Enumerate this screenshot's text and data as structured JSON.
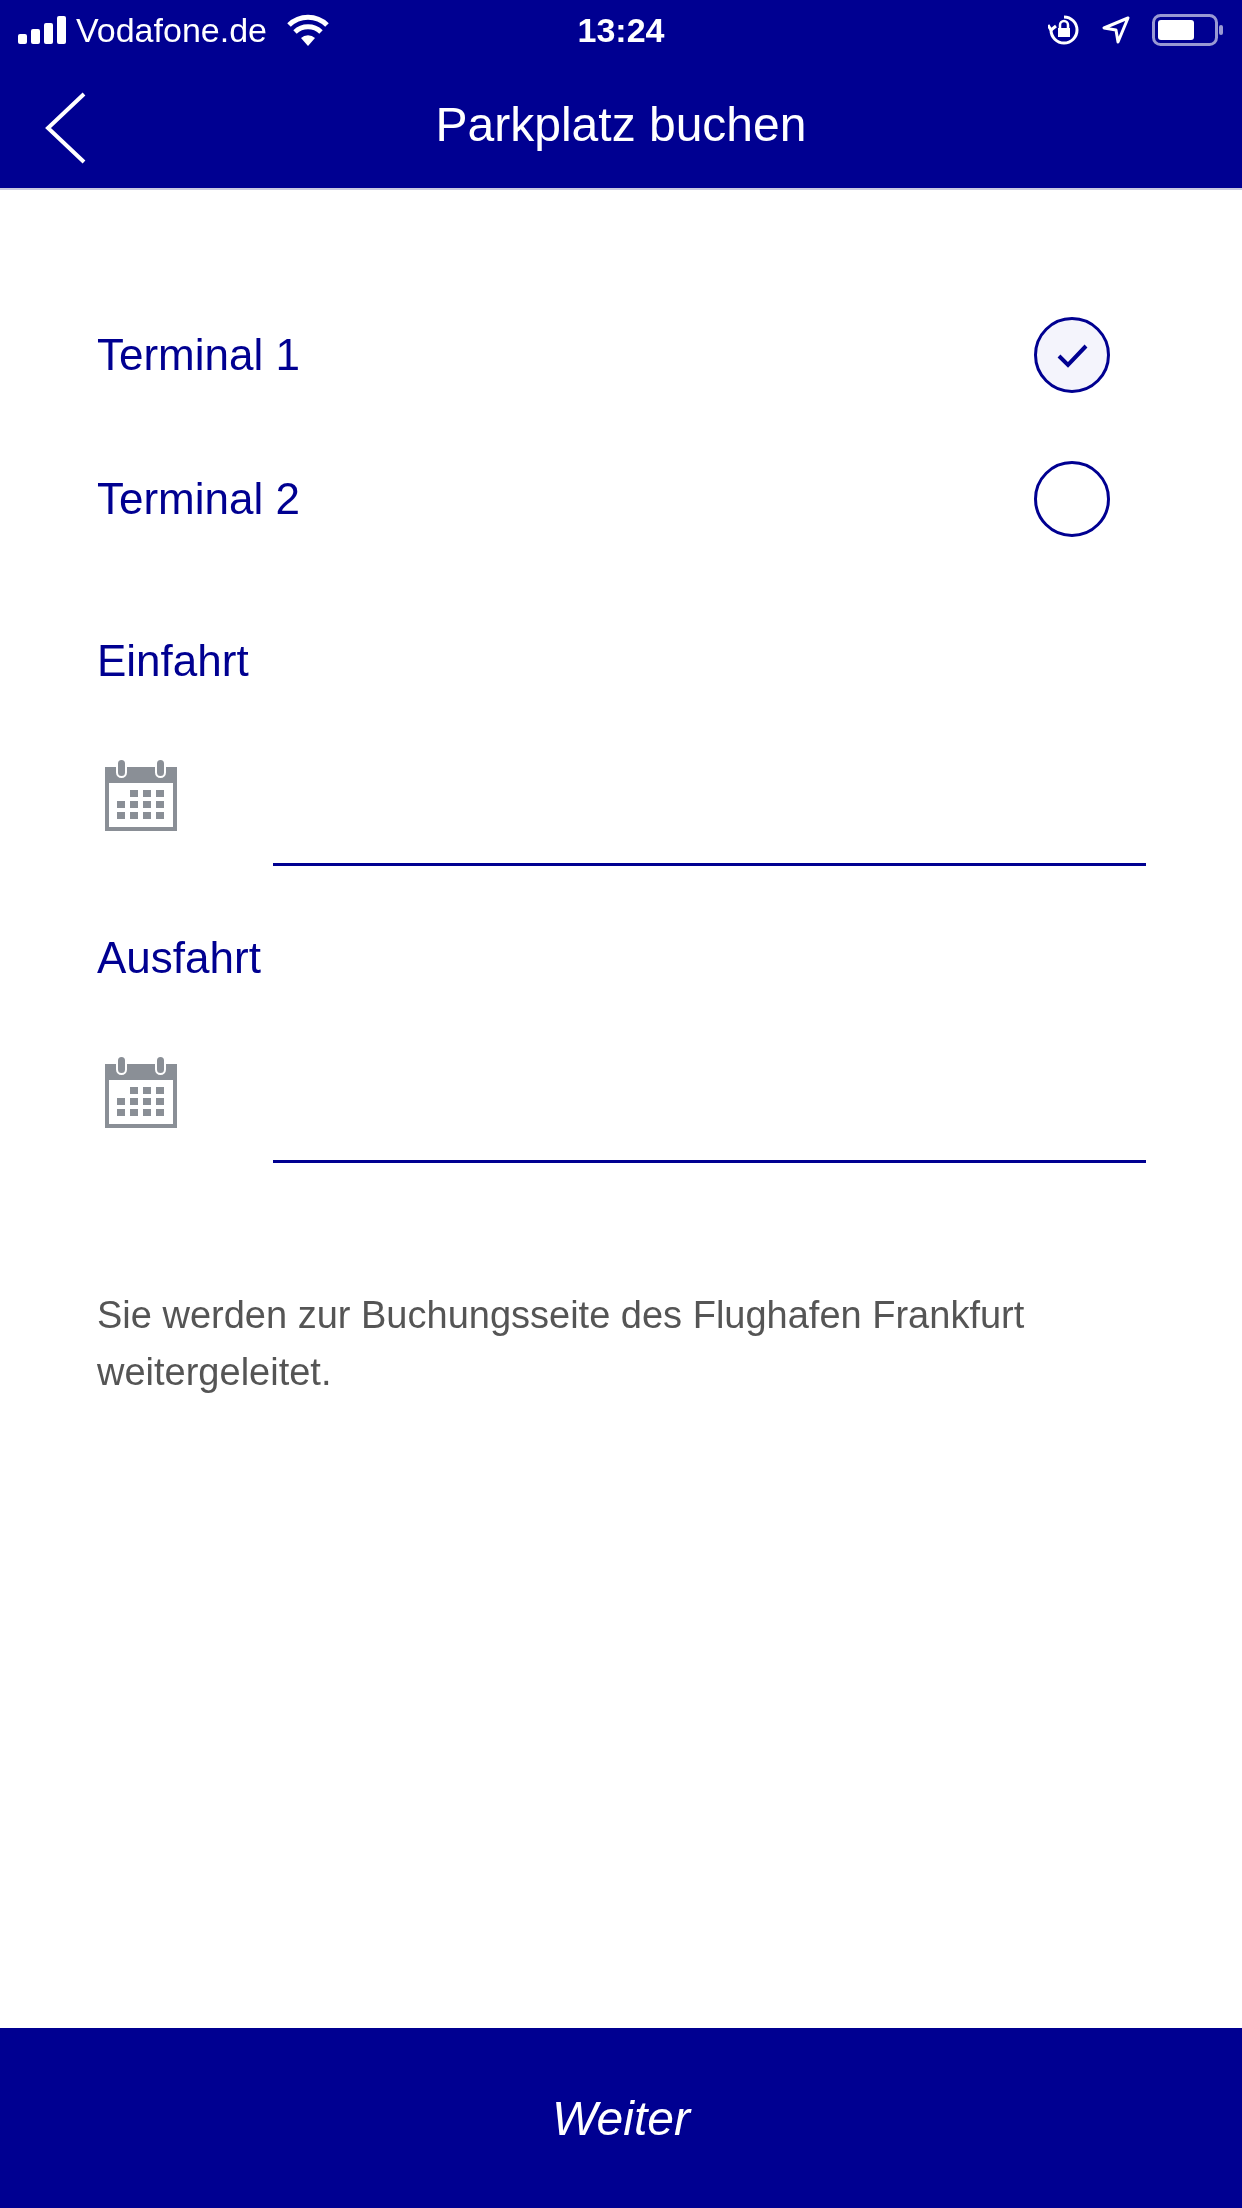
{
  "status_bar": {
    "carrier": "Vodafone.de",
    "time": "13:24"
  },
  "nav_bar": {
    "title": "Parkplatz buchen"
  },
  "terminals": [
    {
      "label": "Terminal 1",
      "selected": true
    },
    {
      "label": "Terminal 2",
      "selected": false
    }
  ],
  "fields": [
    {
      "label": "Einfahrt"
    },
    {
      "label": "Ausfahrt"
    }
  ],
  "note": "Sie werden zur Buchungsseite des Flughafen Frankfurt weitergeleitet.",
  "button": "Weiter"
}
